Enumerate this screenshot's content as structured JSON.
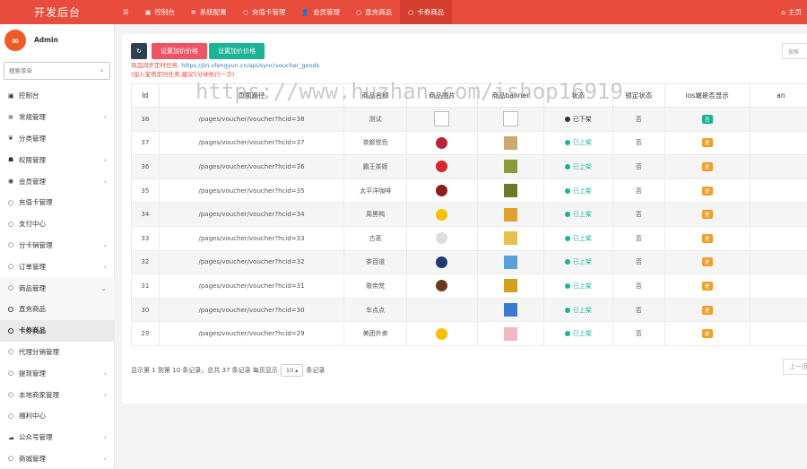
{
  "app": {
    "title": "开发后台",
    "home": "主页"
  },
  "topnav": [
    {
      "label": "控制台",
      "icon": "dashboard-icon",
      "glyph": "▣"
    },
    {
      "label": "系统配置",
      "icon": "gear-icon",
      "glyph": "✲"
    },
    {
      "label": "充值卡管理",
      "icon": "circle-icon",
      "glyph": "○"
    },
    {
      "label": "会员管理",
      "icon": "user-icon",
      "glyph": "👤"
    },
    {
      "label": "直充商品",
      "icon": "circle-icon",
      "glyph": "○"
    },
    {
      "label": "卡券商品",
      "icon": "circle-icon",
      "glyph": "○"
    }
  ],
  "sidebar": {
    "user": "Admin",
    "search_placeholder": "搜索菜单",
    "items": [
      {
        "label": "控制台",
        "icon": "dashboard-icon",
        "glyph": "▣",
        "arrow": false
      },
      {
        "label": "常规管理",
        "icon": "gear-icon",
        "glyph": "✲",
        "arrow": true
      },
      {
        "label": "分类管理",
        "icon": "leaf-icon",
        "glyph": "❦",
        "arrow": false
      },
      {
        "label": "权限管理",
        "icon": "group-icon",
        "glyph": "☗",
        "arrow": true
      },
      {
        "label": "会员管理",
        "icon": "user-icon",
        "glyph": "◉",
        "arrow": true
      },
      {
        "label": "充值卡管理",
        "icon": "circle-icon",
        "glyph": "○",
        "arrow": false
      },
      {
        "label": "支付中心",
        "icon": "circle-icon",
        "glyph": "○",
        "arrow": false
      },
      {
        "label": "分卡销管理",
        "icon": "circle-icon",
        "glyph": "○",
        "arrow": true
      },
      {
        "label": "订单管理",
        "icon": "circle-icon",
        "glyph": "○",
        "arrow": true
      },
      {
        "label": "商品管理",
        "icon": "circle-icon",
        "glyph": "○",
        "arrow": true,
        "expanded": true
      },
      {
        "label": "直充商品",
        "sub": true
      },
      {
        "label": "卡券商品",
        "sub": true,
        "active": true
      },
      {
        "label": "代理分销管理",
        "icon": "circle-icon",
        "glyph": "○",
        "arrow": false
      },
      {
        "label": "提现管理",
        "icon": "circle-icon",
        "glyph": "○",
        "arrow": true
      },
      {
        "label": "本地商家管理",
        "icon": "circle-icon",
        "glyph": "○",
        "arrow": true
      },
      {
        "label": "福利中心",
        "icon": "circle-icon",
        "glyph": "○",
        "arrow": false
      },
      {
        "label": "公众号管理",
        "icon": "wechat-icon",
        "glyph": "☁",
        "arrow": true
      },
      {
        "label": "商城管理",
        "icon": "circle-icon",
        "glyph": "○",
        "arrow": true
      }
    ]
  },
  "toolbar": {
    "btn_price": "设置加价价格",
    "btn_sale_price": "设置加价价格",
    "search_placeholder": "搜索"
  },
  "notice": {
    "line1_prefix": "商品同步定时任务: ",
    "line1_link": "https://jin.vfengyun.cn/api/sync/voucher_goods",
    "line2": "(加入宝塔定时任务,建议5分钟执行一次)"
  },
  "watermark": "https://www.huzhan.com/ishop16919",
  "table": {
    "headers": [
      "Id",
      "页面路径",
      "商品名称",
      "商品图片",
      "商品banner",
      "状态",
      "锁定状态",
      "ios端是否显示",
      "an"
    ],
    "rows": [
      {
        "id": "38",
        "path": "/pages/voucher/voucher?hcid=38",
        "name": "测试",
        "img": "broken",
        "banner": "broken",
        "status": "已下架",
        "status_color": "#333333",
        "lock": "否",
        "ios": "否",
        "ios_color": "#1ab394"
      },
      {
        "id": "37",
        "path": "/pages/voucher/voucher?hcid=37",
        "name": "茶颜悦色",
        "img": "#b4243a",
        "banner": "#c9a96e",
        "status": "已上架",
        "status_color": "#1ab394",
        "lock": "否",
        "ios": "是",
        "ios_color": "#f0a02a"
      },
      {
        "id": "36",
        "path": "/pages/voucher/voucher?hcid=36",
        "name": "霸王茶姬",
        "img": "#d62828",
        "banner": "#8a9a3a",
        "status": "已上架",
        "status_color": "#1ab394",
        "lock": "否",
        "ios": "是",
        "ios_color": "#f0a02a"
      },
      {
        "id": "35",
        "path": "/pages/voucher/voucher?hcid=35",
        "name": "太平洋咖啡",
        "img": "#8b1d1d",
        "banner": "#6b7a2a",
        "status": "已上架",
        "status_color": "#1ab394",
        "lock": "否",
        "ios": "是",
        "ios_color": "#f0a02a"
      },
      {
        "id": "34",
        "path": "/pages/voucher/voucher?hcid=34",
        "name": "周黑鸭",
        "img": "#f2c200",
        "banner": "#e0a030",
        "status": "已上架",
        "status_color": "#1ab394",
        "lock": "否",
        "ios": "是",
        "ios_color": "#f0a02a"
      },
      {
        "id": "33",
        "path": "/pages/voucher/voucher?hcid=33",
        "name": "古茗",
        "img": "#dddddd",
        "banner": "#e8c050",
        "status": "已上架",
        "status_color": "#1ab394",
        "lock": "否",
        "ios": "是",
        "ios_color": "#f0a02a"
      },
      {
        "id": "32",
        "path": "/pages/voucher/voucher?hcid=32",
        "name": "茶百道",
        "img": "#1f3a73",
        "banner": "#5aa0d8",
        "status": "已上架",
        "status_color": "#1ab394",
        "lock": "否",
        "ios": "是",
        "ios_color": "#f0a02a"
      },
      {
        "id": "31",
        "path": "/pages/voucher/voucher?hcid=31",
        "name": "歌帝梵",
        "img": "#6b3a1e",
        "banner": "#d0a020",
        "status": "已上架",
        "status_color": "#1ab394",
        "lock": "否",
        "ios": "是",
        "ios_color": "#f0a02a"
      },
      {
        "id": "30",
        "path": "/pages/voucher/voucher?hcid=30",
        "name": "车点点",
        "img": "none",
        "banner": "#3a7ad0",
        "status": "已上架",
        "status_color": "#1ab394",
        "lock": "否",
        "ios": "是",
        "ios_color": "#f0a02a"
      },
      {
        "id": "29",
        "path": "/pages/voucher/voucher?hcid=29",
        "name": "美团外卖",
        "img": "#f6c000",
        "banner": "#f0b8c0",
        "status": "已上架",
        "status_color": "#1ab394",
        "lock": "否",
        "ios": "是",
        "ios_color": "#f0a02a"
      }
    ]
  },
  "footer": {
    "info": "显示第 1 到第 10 条记录，总共 37 条记录 每页显示",
    "page_size": "10",
    "suffix": "条记录",
    "prev": "上一页"
  }
}
